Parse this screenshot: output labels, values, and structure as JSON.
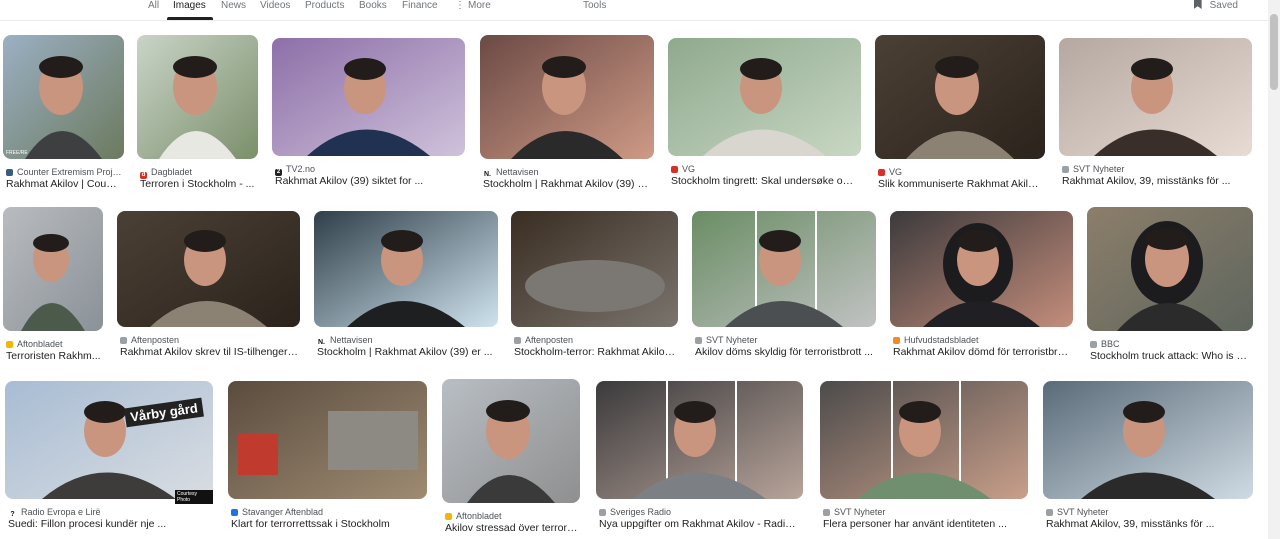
{
  "nav": {
    "all": "All",
    "images": "Images",
    "news": "News",
    "videos": "Videos",
    "products": "Products",
    "books": "Books",
    "finance": "Finance",
    "more": "More",
    "tools": "Tools",
    "saved": "Saved"
  },
  "results": [
    {
      "source": "Counter Extremism Project",
      "title": "Rakhmat Akilov | Count...",
      "fav_color": "#3b5b7a",
      "fav_glyph": "",
      "watermark": "FREE/RE"
    },
    {
      "source": "Dagbladet",
      "title": "Terroren i Stockholm - ...",
      "fav_color": "#d93025",
      "fav_glyph": "d"
    },
    {
      "source": "TV2.no",
      "title": "Rakhmat Akilov (39) siktet for ...",
      "fav_color": "#202124",
      "fav_glyph": "2"
    },
    {
      "source": "Nettavisen",
      "title": "Stockholm | Rakhmat Akilov (39) er ...",
      "fav_color": "#ffffff",
      "fav_glyph": "N."
    },
    {
      "source": "VG",
      "title": "Stockholm tingrett: Skal undersøke om ...",
      "fav_color": "#d93025",
      "fav_glyph": ""
    },
    {
      "source": "VG",
      "title": "Slik kommuniserte Rakhmat Akilov ...",
      "fav_color": "#d93025",
      "fav_glyph": ""
    },
    {
      "source": "SVT Nyheter",
      "title": "Rakhmat Akilov, 39, misstänks för ...",
      "fav_color": "#9aa0a6",
      "fav_glyph": ""
    },
    {
      "source": "Aftonbladet",
      "title": "Terroristen Rakhm...",
      "fav_color": "#f2b705",
      "fav_glyph": ""
    },
    {
      "source": "Aftenposten",
      "title": "Rakhmat Akilov skrev til IS-tilhenger ...",
      "fav_color": "#9aa0a6",
      "fav_glyph": ""
    },
    {
      "source": "Nettavisen",
      "title": "Stockholm | Rakhmat Akilov (39) er ...",
      "fav_color": "#ffffff",
      "fav_glyph": "N."
    },
    {
      "source": "Aftenposten",
      "title": "Stockholm-terror: Rakhmat Akilov ...",
      "fav_color": "#9aa0a6",
      "fav_glyph": ""
    },
    {
      "source": "SVT Nyheter",
      "title": "Akilov döms skyldig för terroristbrott ...",
      "fav_color": "#9aa0a6",
      "fav_glyph": ""
    },
    {
      "source": "Hufvudstadsbladet",
      "title": "Rakhmat Akilov dömd för terroristbrott...",
      "fav_color": "#f28b22",
      "fav_glyph": ""
    },
    {
      "source": "BBC",
      "title": "Stockholm truck attack: Who is R...",
      "fav_color": "#9aa0a6",
      "fav_glyph": ""
    },
    {
      "source": "Radio Evropa e Lirë",
      "title": "Suedi: Fillon procesi kundër nje ...",
      "fav_color": "#ffffff",
      "fav_glyph": "?",
      "sign_text": "Vårby gård",
      "watermark": "Courtesy Photo"
    },
    {
      "source": "Stavanger Aftenblad",
      "title": "Klart for terrorrettssak i Stockholm",
      "fav_color": "#1a73e8",
      "fav_glyph": ""
    },
    {
      "source": "Aftonbladet",
      "title": "Akilov stressad över terrord...",
      "fav_color": "#f2b705",
      "fav_glyph": ""
    },
    {
      "source": "Sveriges Radio",
      "title": "Nya uppgifter om Rakhmat Akilov - Radio ...",
      "fav_color": "#9aa0a6",
      "fav_glyph": ""
    },
    {
      "source": "SVT Nyheter",
      "title": "Flera personer har använt identiteten ...",
      "fav_color": "#9aa0a6",
      "fav_glyph": ""
    },
    {
      "source": "SVT Nyheter",
      "title": "Rakhmat Akilov, 39, misstänks för ...",
      "fav_color": "#9aa0a6",
      "fav_glyph": ""
    }
  ]
}
